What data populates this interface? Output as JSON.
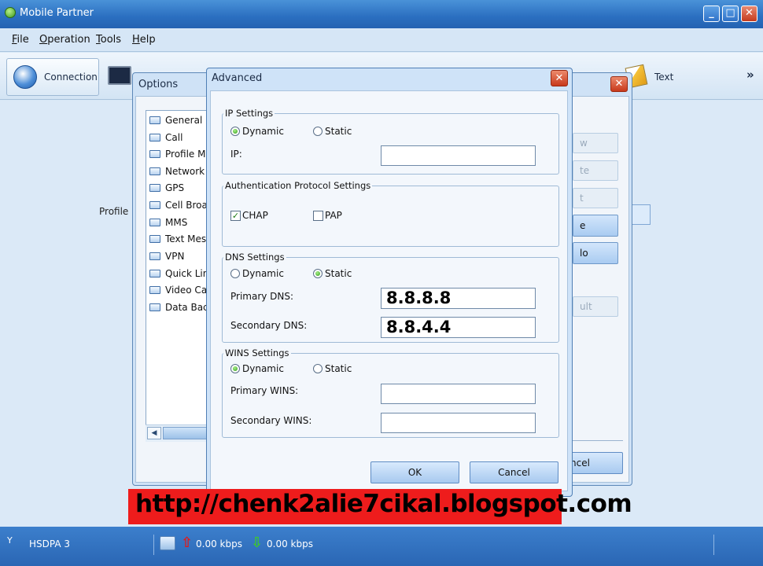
{
  "window": {
    "title": "Mobile Partner"
  },
  "menu": [
    {
      "label": "File",
      "key": "F",
      "rest": "ile"
    },
    {
      "label": "Operation",
      "key": "O",
      "rest": "peration"
    },
    {
      "label": "Tools",
      "key": "T",
      "rest": "ools"
    },
    {
      "label": "Help",
      "key": "H",
      "rest": "elp"
    }
  ],
  "toolbar": {
    "connection_label": "Connection",
    "text_label": "Text",
    "more": "»"
  },
  "main": {
    "profile_label": "Profile N"
  },
  "options": {
    "title": "Options",
    "tree": [
      "General",
      "Call",
      "Profile Mar",
      "Network",
      "GPS",
      "Cell Broad",
      "MMS",
      "Text Mess",
      "VPN",
      "Quick Link",
      "Video Call",
      "Data Back"
    ],
    "buttons": [
      "w",
      "te",
      "t",
      "e",
      "lo",
      "ult"
    ],
    "cancel_label": "ncel"
  },
  "advanced": {
    "title": "Advanced",
    "ip": {
      "title": "IP Settings",
      "dynamic": "Dynamic",
      "static": "Static",
      "ip_label": "IP:",
      "ip_value": ""
    },
    "auth": {
      "title": "Authentication Protocol Settings",
      "chap": "CHAP",
      "pap": "PAP"
    },
    "dns": {
      "title": "DNS Settings",
      "dynamic": "Dynamic",
      "static": "Static",
      "primary_label": "Primary DNS:",
      "primary_value": "8.8.8.8",
      "secondary_label": "Secondary DNS:",
      "secondary_value": "8.8.4.4"
    },
    "wins": {
      "title": "WINS Settings",
      "dynamic": "Dynamic",
      "static": "Static",
      "primary_label": "Primary WINS:",
      "primary_value": "",
      "secondary_label": "Secondary WINS:",
      "secondary_value": ""
    },
    "ok_label": "OK",
    "cancel_label": "Cancel"
  },
  "status": {
    "signal": "Y",
    "network": "HSDPA  3",
    "upload": "0.00 kbps",
    "download": "0.00 kbps"
  },
  "banner": "http://chenk2alie7cikal.blogspot.com"
}
